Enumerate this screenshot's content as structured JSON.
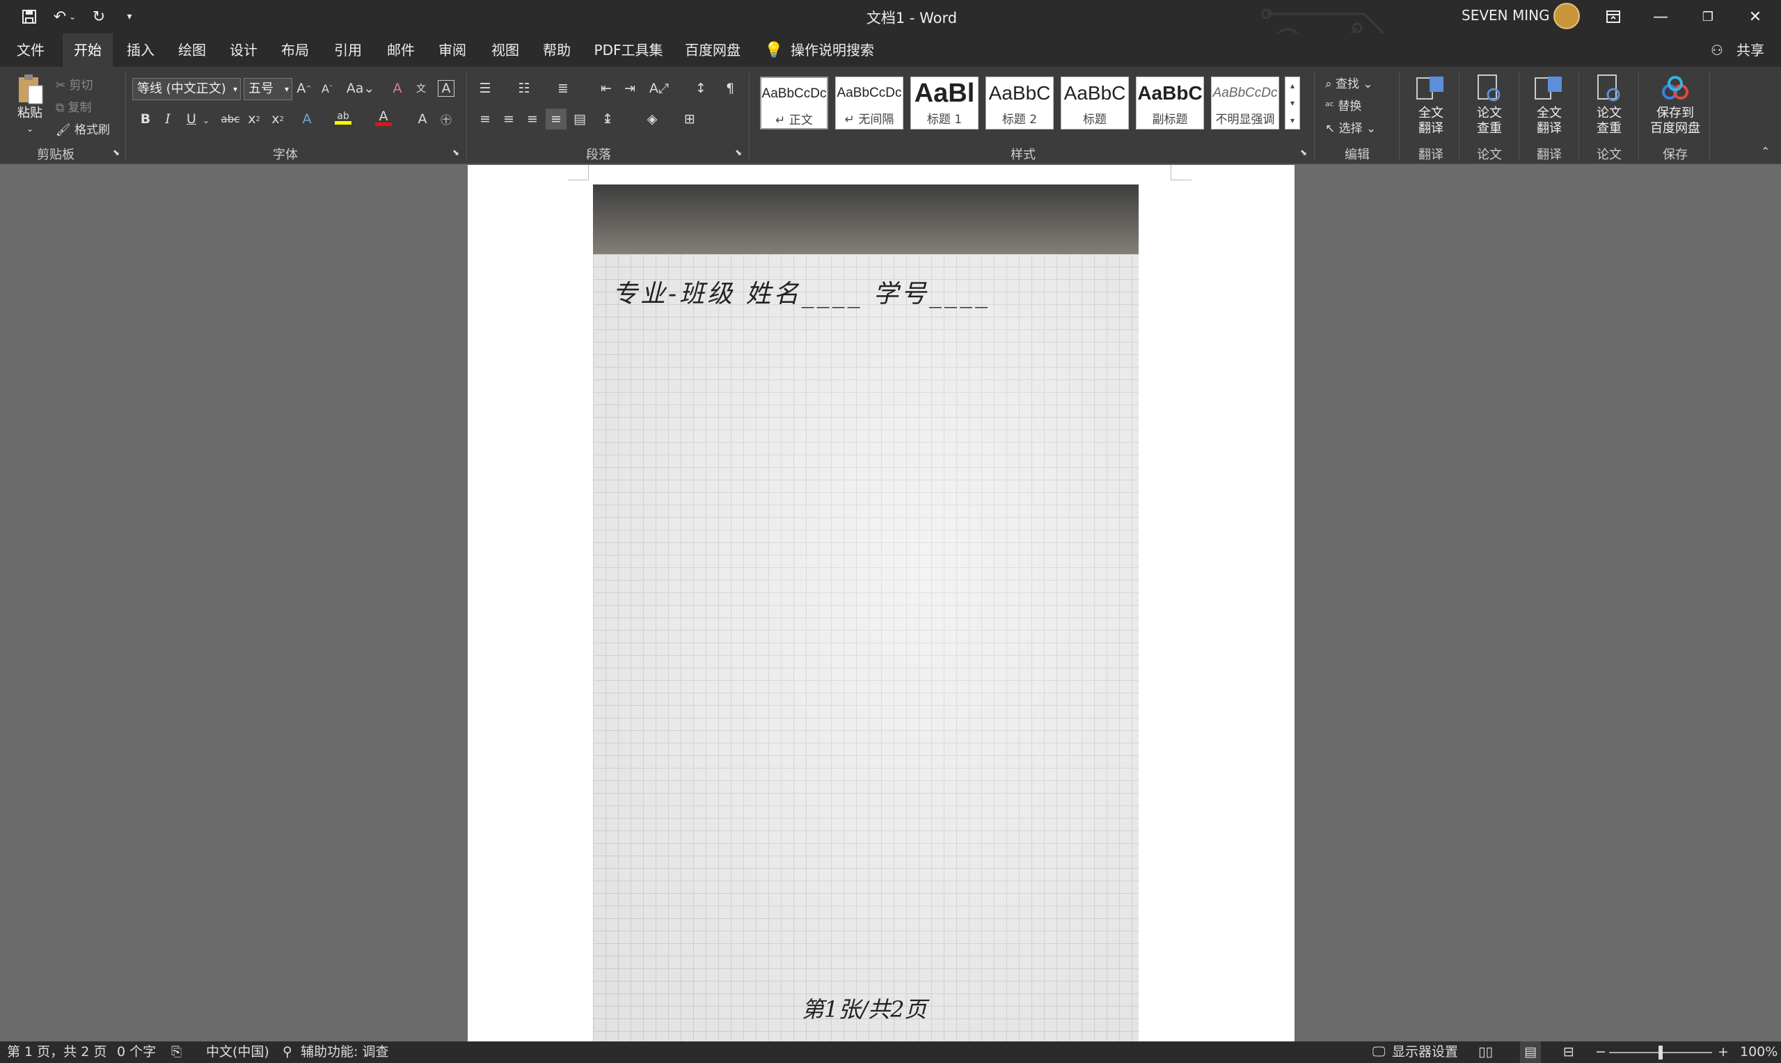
{
  "titlebar": {
    "doc_title": "文档1  -  Word",
    "user_name": "SEVEN MING",
    "qat": [
      "save-icon",
      "undo-icon",
      "redo-icon",
      "customize-icon"
    ]
  },
  "tabs": [
    "文件",
    "开始",
    "插入",
    "绘图",
    "设计",
    "布局",
    "引用",
    "邮件",
    "审阅",
    "视图",
    "帮助",
    "PDF工具集",
    "百度网盘"
  ],
  "active_tab": "开始",
  "tell_me": "操作说明搜索",
  "share": "共享",
  "ribbon": {
    "clipboard": {
      "paste": "粘贴",
      "cut": "剪切",
      "copy": "复制",
      "format_painter": "格式刷",
      "label": "剪贴板"
    },
    "font": {
      "font_name": "等线 (中文正文)",
      "font_size": "五号",
      "label": "字体"
    },
    "paragraph": {
      "label": "段落"
    },
    "styles": {
      "label": "样式",
      "items": [
        {
          "preview": "AaBbCcDc",
          "name": "↵ 正文"
        },
        {
          "preview": "AaBbCcDc",
          "name": "↵ 无间隔"
        },
        {
          "preview": "AaBl",
          "name": "标题 1"
        },
        {
          "preview": "AaBbC",
          "name": "标题 2"
        },
        {
          "preview": "AaBbC",
          "name": "标题"
        },
        {
          "preview": "AaBbC",
          "name": "副标题"
        },
        {
          "preview": "AaBbCcDc",
          "name": "不明显强调"
        }
      ]
    },
    "editing": {
      "find": "查找",
      "replace": "替换",
      "select": "选择",
      "label": "编辑"
    },
    "extras": [
      {
        "line1": "全文",
        "line2": "翻译",
        "label": "翻译"
      },
      {
        "line1": "论文",
        "line2": "查重",
        "label": "论文"
      },
      {
        "line1": "全文",
        "line2": "翻译",
        "label": "翻译"
      },
      {
        "line1": "论文",
        "line2": "查重",
        "label": "论文"
      },
      {
        "line1": "保存到",
        "line2": "百度网盘",
        "label": "保存"
      }
    ]
  },
  "document": {
    "handwriting_header": "专业-班级  姓名____  学号____",
    "handwriting_footer": "第1张/共2页"
  },
  "status": {
    "page": "第 1 页，共 2 页",
    "words": "0 个字",
    "language": "中文(中国)",
    "accessibility": "辅助功能: 调查",
    "display_settings": "显示器设置",
    "zoom": "100%",
    "zoom_level": 0.5
  }
}
